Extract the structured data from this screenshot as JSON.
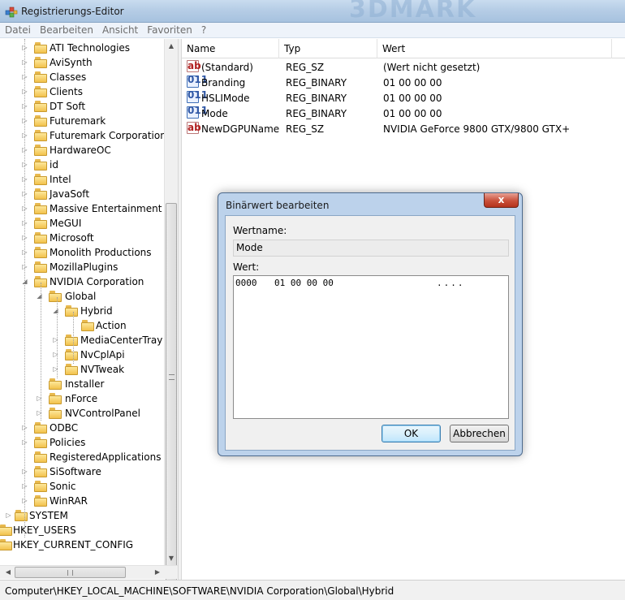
{
  "window": {
    "title": "Registrierungs-Editor"
  },
  "menu": [
    "Datei",
    "Bearbeiten",
    "Ansicht",
    "Favoriten",
    "?"
  ],
  "tree": [
    {
      "label": "ATI Technologies",
      "level": 2,
      "expander": "collapsed"
    },
    {
      "label": "AviSynth",
      "level": 2,
      "expander": "collapsed"
    },
    {
      "label": "Classes",
      "level": 2,
      "expander": "collapsed"
    },
    {
      "label": "Clients",
      "level": 2,
      "expander": "collapsed"
    },
    {
      "label": "DT Soft",
      "level": 2,
      "expander": "collapsed"
    },
    {
      "label": "Futuremark",
      "level": 2,
      "expander": "collapsed"
    },
    {
      "label": "Futuremark Corporation",
      "level": 2,
      "expander": "collapsed"
    },
    {
      "label": "HardwareOC",
      "level": 2,
      "expander": "collapsed"
    },
    {
      "label": "id",
      "level": 2,
      "expander": "collapsed"
    },
    {
      "label": "Intel",
      "level": 2,
      "expander": "collapsed"
    },
    {
      "label": "JavaSoft",
      "level": 2,
      "expander": "collapsed"
    },
    {
      "label": "Massive Entertainment AB",
      "level": 2,
      "expander": "collapsed"
    },
    {
      "label": "MeGUI",
      "level": 2,
      "expander": "collapsed"
    },
    {
      "label": "Microsoft",
      "level": 2,
      "expander": "collapsed"
    },
    {
      "label": "Monolith Productions",
      "level": 2,
      "expander": "collapsed"
    },
    {
      "label": "MozillaPlugins",
      "level": 2,
      "expander": "collapsed"
    },
    {
      "label": "NVIDIA Corporation",
      "level": 2,
      "expander": "expanded"
    },
    {
      "label": "Global",
      "level": 3,
      "expander": "expanded"
    },
    {
      "label": "Hybrid",
      "level": 4,
      "expander": "expanded"
    },
    {
      "label": "Action",
      "level": 5,
      "expander": "none"
    },
    {
      "label": "MediaCenterTray",
      "level": 4,
      "expander": "collapsed"
    },
    {
      "label": "NvCplApi",
      "level": 4,
      "expander": "collapsed"
    },
    {
      "label": "NVTweak",
      "level": 4,
      "expander": "collapsed"
    },
    {
      "label": "Installer",
      "level": 3,
      "expander": "none"
    },
    {
      "label": "nForce",
      "level": 3,
      "expander": "collapsed"
    },
    {
      "label": "NVControlPanel",
      "level": 3,
      "expander": "collapsed"
    },
    {
      "label": "ODBC",
      "level": 2,
      "expander": "collapsed"
    },
    {
      "label": "Policies",
      "level": 2,
      "expander": "collapsed"
    },
    {
      "label": "RegisteredApplications",
      "level": 2,
      "expander": "none"
    },
    {
      "label": "SiSoftware",
      "level": 2,
      "expander": "collapsed"
    },
    {
      "label": "Sonic",
      "level": 2,
      "expander": "collapsed"
    },
    {
      "label": "WinRAR",
      "level": 2,
      "expander": "collapsed"
    },
    {
      "label": "SYSTEM",
      "level": 1,
      "expander": "collapsed"
    },
    {
      "label": "HKEY_USERS",
      "level": 0,
      "expander": "collapsed"
    },
    {
      "label": "HKEY_CURRENT_CONFIG",
      "level": 0,
      "expander": "collapsed"
    }
  ],
  "list": {
    "columns": [
      "Name",
      "Typ",
      "Wert"
    ],
    "rows": [
      {
        "icon": "string-value-icon",
        "name": "(Standard)",
        "type": "REG_SZ",
        "value": "(Wert nicht gesetzt)"
      },
      {
        "icon": "binary-value-icon",
        "name": "Branding",
        "type": "REG_BINARY",
        "value": "01 00 00 00"
      },
      {
        "icon": "binary-value-icon",
        "name": "HSLIMode",
        "type": "REG_BINARY",
        "value": "01 00 00 00"
      },
      {
        "icon": "binary-value-icon",
        "name": "Mode",
        "type": "REG_BINARY",
        "value": "01 00 00 00"
      },
      {
        "icon": "string-value-icon",
        "name": "NewDGPUName",
        "type": "REG_SZ",
        "value": "NVIDIA GeForce 9800 GTX/9800 GTX+"
      }
    ]
  },
  "status": {
    "path": "Computer\\HKEY_LOCAL_MACHINE\\SOFTWARE\\NVIDIA Corporation\\Global\\Hybrid"
  },
  "dialog": {
    "title": "Binärwert bearbeiten",
    "close_label": "x",
    "name_label": "Wertname:",
    "name_value": "Mode",
    "value_label": "Wert:",
    "hex_offset": "0000",
    "hex_bytes": "01 00 00 00",
    "hex_ascii": "....",
    "ok_label": "OK",
    "cancel_label": "Abbrechen"
  },
  "icons": {
    "app": "registry-editor-icon",
    "folder": "folder-icon",
    "expand": "expander-triangle-icon",
    "close": "close-icon"
  },
  "colors": {
    "title_bar": "#b6cde6",
    "dialog_frame": "#bcd2eb",
    "close_button": "#c9503a",
    "folder": "#f2c24c",
    "ok_button": "#bee6fd"
  }
}
